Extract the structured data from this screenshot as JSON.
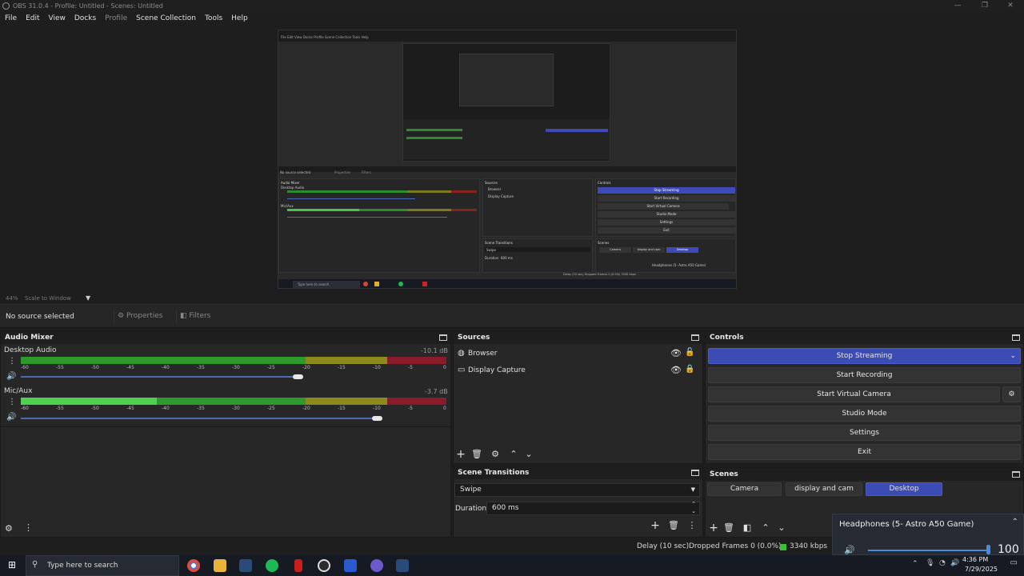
{
  "window": {
    "title": "OBS 31.0.4 - Profile: Untitled - Scenes: Untitled",
    "controls": [
      "—",
      "❐",
      "✕"
    ]
  },
  "menu": [
    "File",
    "Edit",
    "View",
    "Docks",
    "Profile",
    "Scene Collection",
    "Tools",
    "Help"
  ],
  "preview": {
    "zoom": "44%",
    "scale_mode": "Scale to Window",
    "inner": {
      "menu": [
        "File",
        "Edit",
        "View",
        "Docks",
        "Profile",
        "Scene Collection",
        "Tools",
        "Help"
      ],
      "no_source": "No source selected",
      "properties": "Properties",
      "filters": "Filters",
      "audio_mixer": "Audio Mixer",
      "desktop_audio": "Desktop Audio",
      "mic_aux": "Mic/Aux",
      "sources": "Sources",
      "browser": "Browser",
      "display_capture": "Display Capture",
      "scene_transitions": "Scene Transitions",
      "swipe": "Swipe",
      "duration_label": "Duration",
      "duration": "600 ms",
      "controls": "Controls",
      "stop_streaming": "Stop Streaming",
      "start_recording": "Start Recording",
      "start_virtual_camera": "Start Virtual Camera",
      "studio_mode": "Studio Mode",
      "settings": "Settings",
      "exit": "Exit",
      "scenes": "Scenes",
      "camera": "Camera",
      "display_and_cam": "display and cam",
      "desktop": "Desktop",
      "headphones": "Headphones (5- Astro A50 Game)",
      "search": "Type here to search",
      "status": "Delay (10 sec)   Dropped Frames 0 (0.0%)   3340 kbps"
    }
  },
  "source_toolbar": {
    "no_source": "No source selected",
    "properties": "Properties",
    "filters": "Filters"
  },
  "audio_mixer": {
    "title": "Audio Mixer",
    "channels": [
      {
        "name": "Desktop Audio",
        "db": "-10.1 dB",
        "level": 0.0,
        "volume": 0.63
      },
      {
        "name": "Mic/Aux",
        "db": "-3.7 dB",
        "level": 0.32,
        "volume": 0.81
      }
    ],
    "ticks": [
      "-60",
      "-55",
      "-50",
      "-45",
      "-40",
      "-35",
      "-30",
      "-25",
      "-20",
      "-15",
      "-10",
      "-5",
      "0"
    ]
  },
  "sources": {
    "title": "Sources",
    "items": [
      {
        "name": "Browser"
      },
      {
        "name": "Display Capture"
      }
    ]
  },
  "scene_transitions": {
    "title": "Scene Transitions",
    "transition": "Swipe",
    "duration_label": "Duration",
    "duration": "600 ms"
  },
  "controls": {
    "title": "Controls",
    "stop_streaming": "Stop Streaming",
    "start_recording": "Start Recording",
    "start_virtual_camera": "Start Virtual Camera",
    "studio_mode": "Studio Mode",
    "settings": "Settings",
    "exit": "Exit"
  },
  "scenes": {
    "title": "Scenes",
    "items": [
      "Camera",
      "display and cam",
      "Desktop"
    ],
    "active": "Desktop"
  },
  "status": {
    "delay": "Delay (10 sec)",
    "dropped": "Dropped Frames 0 (0.0%)",
    "bitrate": "3340 kbps"
  },
  "volume_popup": {
    "device": "Headphones (5- Astro A50 Game)",
    "value": "100"
  },
  "taskbar": {
    "search_placeholder": "Type here to search",
    "time": "4:36 PM",
    "date": "7/29/2025"
  },
  "colors": {
    "accent_blue": "#3c4cb5",
    "meter_green": "#2e9a2e",
    "meter_green_bright": "#4fd04f",
    "meter_yellow": "#8c8a1c",
    "meter_red": "#8a1c2a"
  }
}
